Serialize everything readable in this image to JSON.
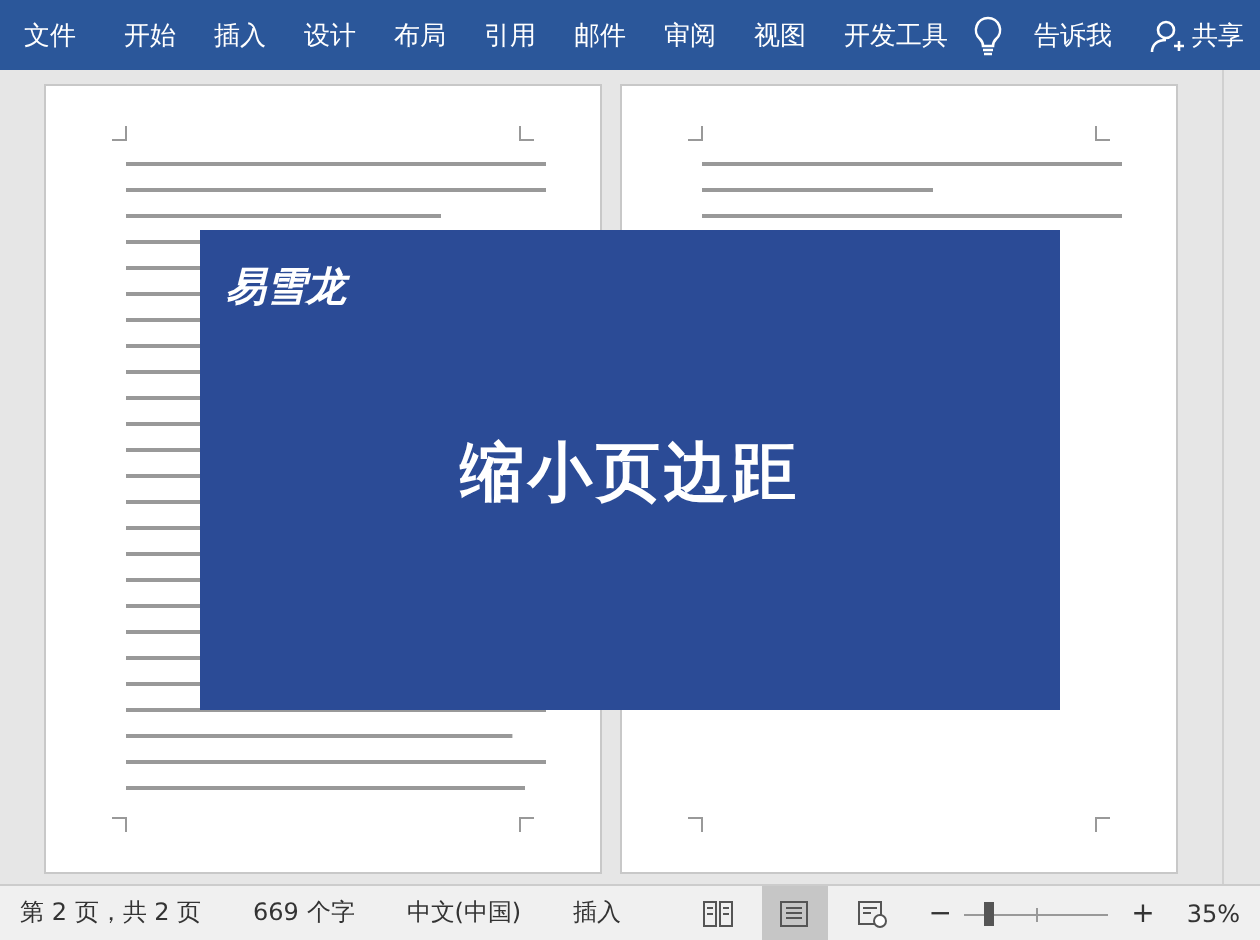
{
  "ribbon": {
    "tabs": [
      {
        "label": "文件"
      },
      {
        "label": "开始"
      },
      {
        "label": "插入"
      },
      {
        "label": "设计"
      },
      {
        "label": "布局"
      },
      {
        "label": "引用"
      },
      {
        "label": "邮件"
      },
      {
        "label": "审阅"
      },
      {
        "label": "视图"
      },
      {
        "label": "开发工具"
      }
    ],
    "tell_me": "告诉我",
    "share": "共享"
  },
  "overlay": {
    "logo": "易雪龙",
    "title": "缩小页边距"
  },
  "status_bar": {
    "page": "第 2 页，共 2 页",
    "words": "669 个字",
    "language": "中文(中国)",
    "mode": "插入",
    "views": [
      {
        "kind": "read",
        "selected": false
      },
      {
        "kind": "print",
        "selected": true
      },
      {
        "kind": "web",
        "selected": false
      }
    ],
    "zoom": {
      "minus": "−",
      "plus": "+",
      "level": 0.17,
      "reading": "35%"
    }
  }
}
